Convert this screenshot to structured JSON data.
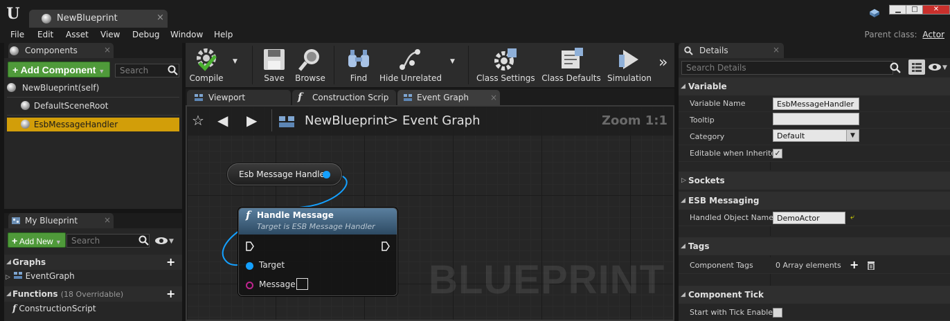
{
  "window": {
    "logo_text": "U",
    "document_tab": "NewBlueprint",
    "tab_close": "×",
    "controls": [
      "▁",
      "□",
      "✕"
    ]
  },
  "menu": {
    "items": [
      "File",
      "Edit",
      "Asset",
      "View",
      "Debug",
      "Window",
      "Help"
    ],
    "parent_class_label": "Parent class:",
    "parent_class_value": "Actor"
  },
  "components": {
    "tab_label": "Components",
    "add_button": "Add Component",
    "search_placeholder": "Search",
    "tree": [
      {
        "label": "NewBlueprint(self)",
        "selected": false
      },
      {
        "label": "DefaultSceneRoot",
        "selected": false
      },
      {
        "label": "EsbMessageHandler",
        "selected": true
      }
    ]
  },
  "my_blueprint": {
    "tab_label": "My Blueprint",
    "add_button": "Add New",
    "search_placeholder": "Search",
    "sections": [
      {
        "title": "Graphs",
        "count": "",
        "items": [
          "EventGraph"
        ]
      },
      {
        "title": "Functions",
        "count": "(18 Overridable)",
        "items": [
          "ConstructionScript"
        ]
      }
    ]
  },
  "toolbar": {
    "tools": [
      {
        "label": "Compile",
        "icon": "compile-icon",
        "has_menu": true
      },
      {
        "label": "Save",
        "icon": "save-icon",
        "has_menu": false
      },
      {
        "label": "Browse",
        "icon": "browse-icon",
        "has_menu": false
      },
      {
        "label": "Find",
        "icon": "find-icon",
        "has_menu": false
      },
      {
        "label": "Hide Unrelated",
        "icon": "hide-unrelated-icon",
        "has_menu": true
      },
      {
        "label": "Class Settings",
        "icon": "class-settings-icon",
        "has_menu": false
      },
      {
        "label": "Class Defaults",
        "icon": "class-defaults-icon",
        "has_menu": false
      },
      {
        "label": "Simulation",
        "icon": "simulation-icon",
        "has_menu": false
      }
    ],
    "overflow": "»"
  },
  "graph_tabs": [
    {
      "label": "Viewport",
      "icon": "viewport-icon",
      "active": false
    },
    {
      "label": "Construction Scrip",
      "icon": "function-icon",
      "active": false
    },
    {
      "label": "Event Graph",
      "icon": "event-graph-icon",
      "active": true
    }
  ],
  "graph": {
    "breadcrumb_blueprint": "NewBlueprint",
    "breadcrumb_separator": ">",
    "breadcrumb_graph": "Event Graph",
    "zoom": "Zoom 1:1",
    "watermark": "BLUEPRINT",
    "variable_node": {
      "label": "Esb Message Handler"
    },
    "function_node": {
      "symbol": "f",
      "title": "Handle Message",
      "subtitle": "Target is ESB Message Handler",
      "pins": [
        "Target",
        "Message"
      ]
    }
  },
  "details": {
    "tab_label": "Details",
    "search_placeholder": "Search Details",
    "categories": {
      "variable": "Variable",
      "sockets": "Sockets",
      "esb_messaging": "ESB Messaging",
      "tags": "Tags",
      "component_tick": "Component Tick"
    },
    "props": {
      "variable_name": {
        "name": "Variable Name",
        "value": "EsbMessageHandler"
      },
      "tooltip": {
        "name": "Tooltip",
        "value": ""
      },
      "category": {
        "name": "Category",
        "value": "Default"
      },
      "editable_when_inherited": {
        "name": "Editable when Inherited",
        "checked": true
      },
      "handled_object_name": {
        "name": "Handled Object Name",
        "value": "DemoActor"
      },
      "component_tags": {
        "name": "Component Tags",
        "value": "0 Array elements"
      },
      "start_with_tick_enabled": {
        "name": "Start with Tick Enabled",
        "checked": false
      }
    }
  }
}
